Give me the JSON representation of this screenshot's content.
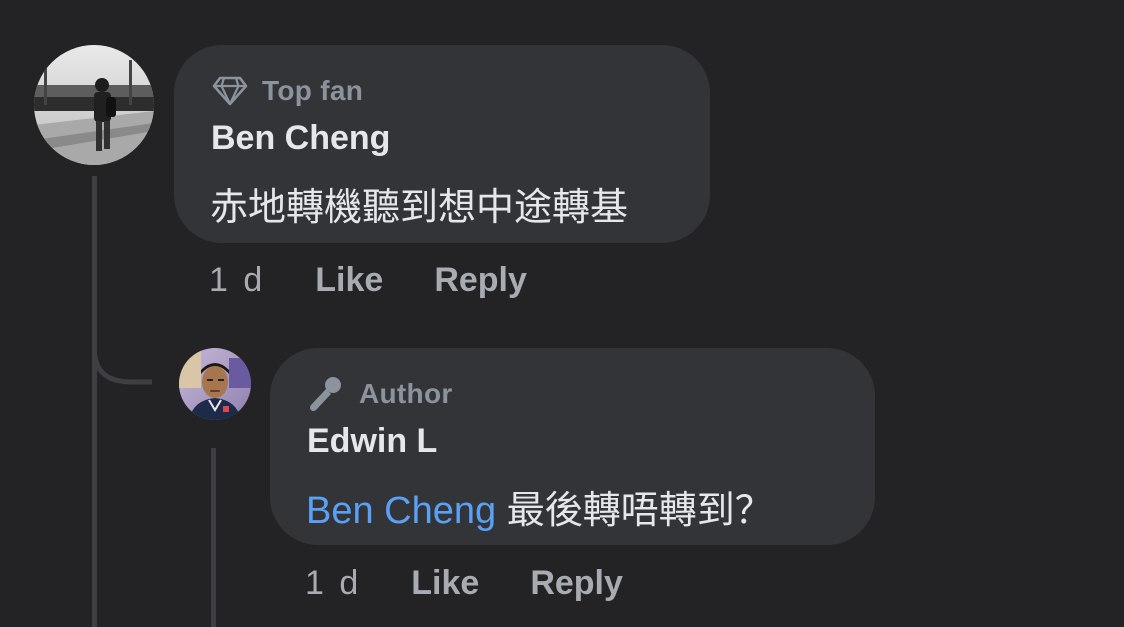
{
  "comments": [
    {
      "badge": "Top fan",
      "badge_icon": "diamond-icon",
      "author": "Ben Cheng",
      "text": "赤地轉機聽到想中途轉基",
      "time": "1 d",
      "like_label": "Like",
      "reply_label": "Reply"
    },
    {
      "badge": "Author",
      "badge_icon": "microphone-icon",
      "author": "Edwin L",
      "mention": "Ben Cheng",
      "text": "最後轉唔轉到？",
      "time": "1 d",
      "like_label": "Like",
      "reply_label": "Reply"
    }
  ],
  "colors": {
    "background": "#232325",
    "bubble": "#333437",
    "mention": "#5aa0f5",
    "muted": "#8d939c"
  }
}
